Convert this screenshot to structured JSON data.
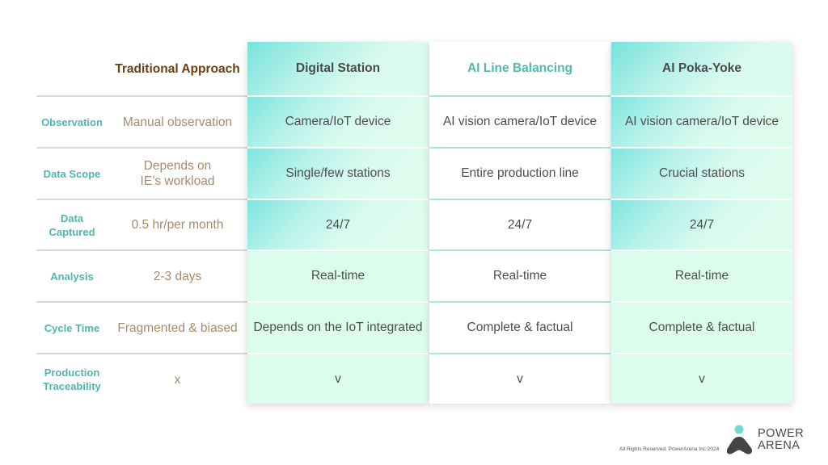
{
  "headers": {
    "traditional": "Traditional Approach",
    "digital_station": "Digital Station",
    "ai_line_balancing": "AI Line Balancing",
    "ai_poka_yoke": "AI Poka-Yoke"
  },
  "rows": [
    {
      "label": "Observation",
      "traditional": "Manual observation",
      "digital_station": "Camera/IoT device",
      "ai_line_balancing": "AI vision camera/IoT device",
      "ai_poka_yoke": "AI vision camera/IoT device"
    },
    {
      "label": "Data Scope",
      "traditional": "Depends on IE’s workload",
      "digital_station": "Single/few stations",
      "ai_line_balancing": "Entire production line",
      "ai_poka_yoke": "Crucial stations"
    },
    {
      "label": "Data Captured",
      "traditional": "0.5 hr/per month",
      "digital_station": "24/7",
      "ai_line_balancing": "24/7",
      "ai_poka_yoke": "24/7"
    },
    {
      "label": "Analysis",
      "traditional": "2-3 days",
      "digital_station": "Real-time",
      "ai_line_balancing": "Real-time",
      "ai_poka_yoke": "Real-time"
    },
    {
      "label": "Cycle Time",
      "traditional": "Fragmented & biased",
      "digital_station": "Depends on the IoT integrated",
      "ai_line_balancing": "Complete & factual",
      "ai_poka_yoke": "Complete & factual"
    },
    {
      "label": "Production Traceability",
      "traditional": "x",
      "digital_station": "v",
      "ai_line_balancing": "v",
      "ai_poka_yoke": "v"
    }
  ],
  "footer": {
    "copyright": "All Rights Reserved. PowerArena Inc 2024",
    "logo_line1": "POWER",
    "logo_line2": "ARENA",
    "logo_icon": "powerarena-logo-icon"
  },
  "colors": {
    "teal_accent": "#55b8b0",
    "traditional_header": "#6b3f0f",
    "traditional_text": "#a88a6d",
    "highlight_start": "#76e3dc",
    "highlight_end": "#dcfbee",
    "logo_dot": "#6fd9d3",
    "logo_dark": "#444444"
  }
}
